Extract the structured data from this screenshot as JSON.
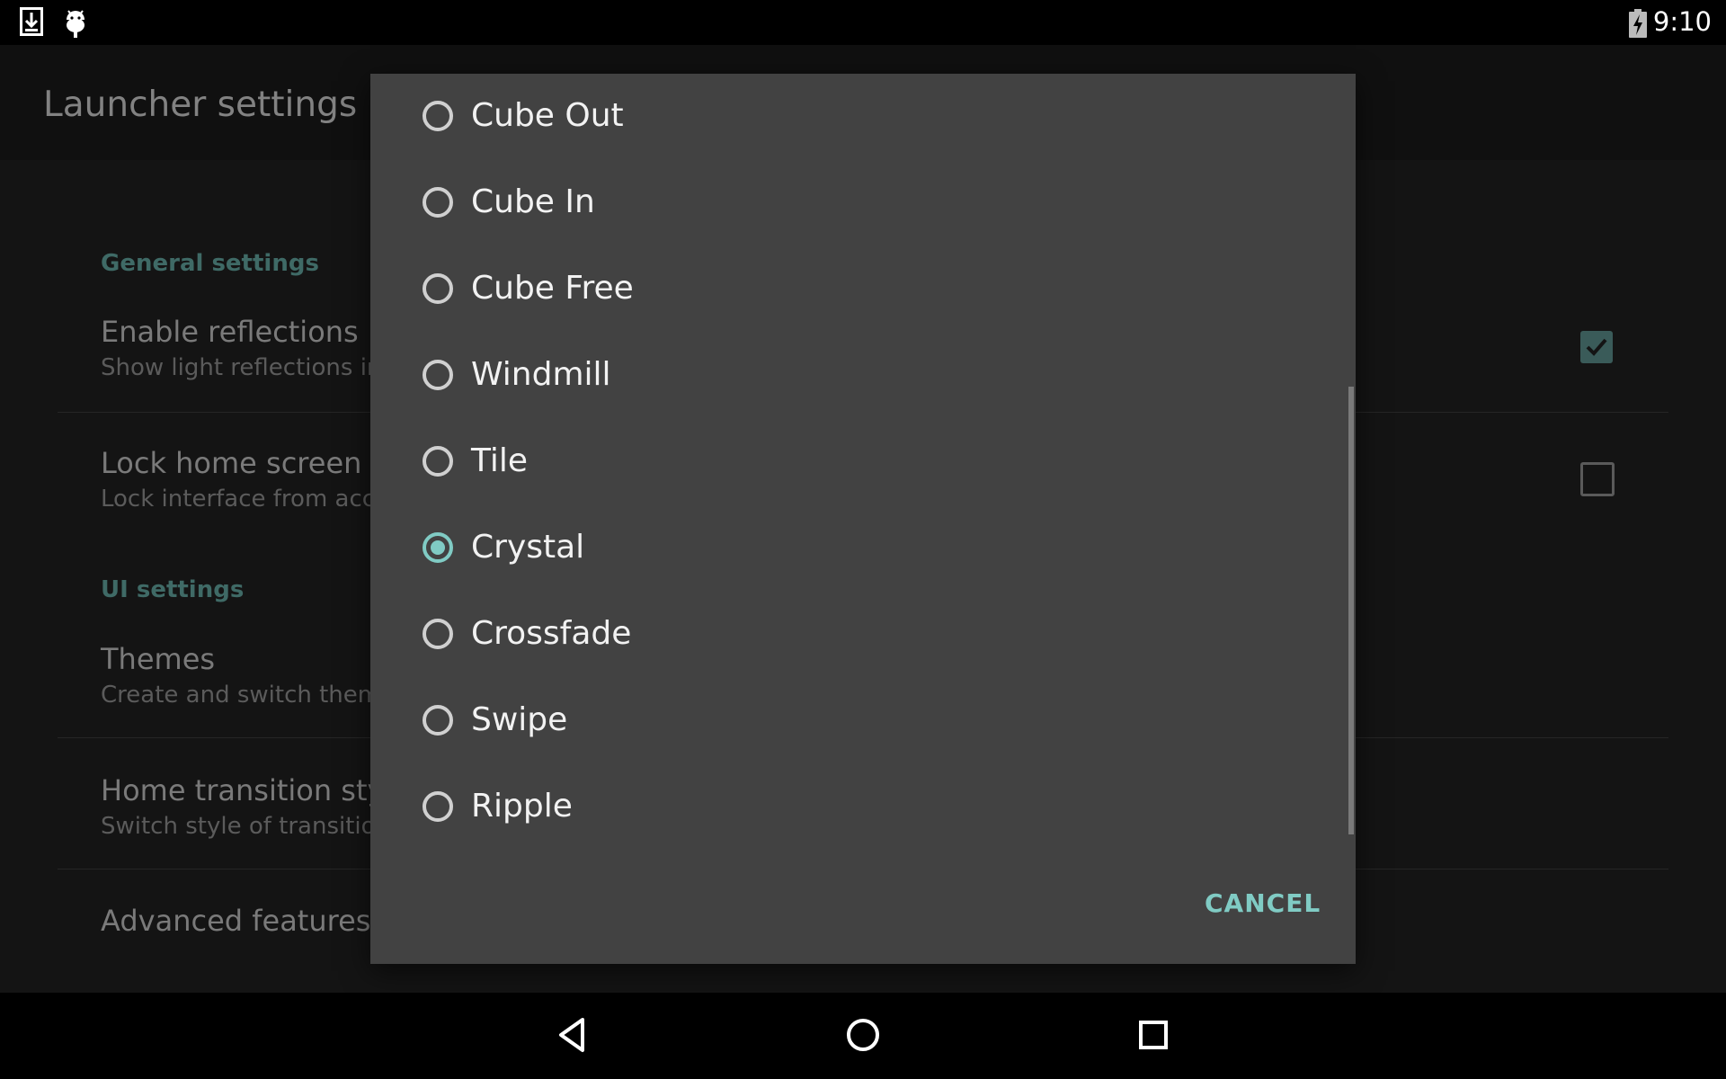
{
  "status_bar": {
    "time": "9:10",
    "icons": [
      "download-icon",
      "android-debug-icon",
      "battery-charging-icon"
    ]
  },
  "app": {
    "title": "Launcher settings",
    "sections": [
      {
        "header": "General settings",
        "items": [
          {
            "title": "Enable reflections",
            "summary": "Show light reflections in",
            "checked": true
          },
          {
            "title": "Lock home screen",
            "summary": "Lock interface from acci",
            "checked": false
          }
        ]
      },
      {
        "header": "UI settings",
        "items": [
          {
            "title": "Themes",
            "summary": "Create and switch theme"
          },
          {
            "title": "Home transition style",
            "summary": "Switch style of transition"
          },
          {
            "title": "Advanced features"
          }
        ]
      }
    ]
  },
  "dialog": {
    "options": [
      "Cube Out",
      "Cube In",
      "Cube Free",
      "Windmill",
      "Tile",
      "Crystal",
      "Crossfade",
      "Swipe",
      "Ripple"
    ],
    "selected": "Crystal",
    "cancel_label": "CANCEL"
  },
  "nav_bar": {
    "buttons": [
      "back-icon",
      "home-icon",
      "recents-icon"
    ]
  },
  "colors": {
    "accent": "#80cbc4",
    "dialog_bg": "#424242",
    "section_header": "#3f6a66"
  }
}
